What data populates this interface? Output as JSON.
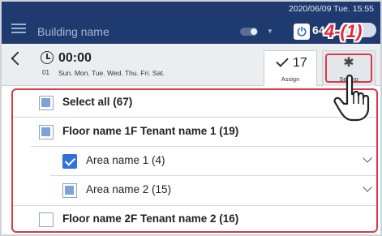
{
  "appbar": {
    "building_name": "Building name",
    "datetime": "2020/06/09 Tue. 15:55",
    "power_value": "64"
  },
  "header": {
    "time": "00:00",
    "schedule_no": "01",
    "days": "Sun. Mon. Tue. Wed. Thu. Fri. Sat.",
    "assign_count": "17",
    "assign_label": "Assign",
    "setting_label": "Setting"
  },
  "callout": {
    "label": "4-(1)"
  },
  "list": {
    "select_all": "Select all (67)",
    "floor1": "Floor name 1F Tenant name 1 (19)",
    "area1": "Area name 1 (4)",
    "area2": "Area name 2 (15)",
    "floor2": "Floor name 2F Tenant name 2 (16)"
  },
  "colors": {
    "appbar": "#1f3a6e",
    "accent": "#2f73d8",
    "highlight": "#d93a4a"
  }
}
